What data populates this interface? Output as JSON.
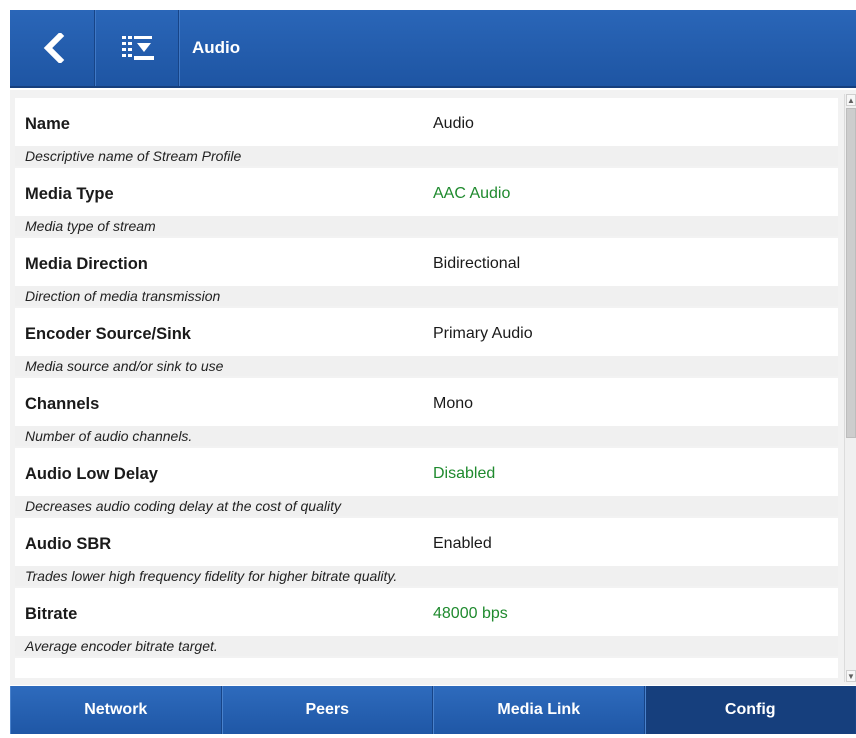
{
  "header": {
    "back_icon": "back-chevron-icon",
    "menu_icon": "list-download-icon",
    "title": "Audio"
  },
  "rows": [
    {
      "name": "Name",
      "value": "Audio",
      "desc": "Descriptive name of Stream Profile",
      "value_color": "#1a1a1a"
    },
    {
      "name": "Media Type",
      "value": "AAC Audio",
      "desc": "Media type of stream",
      "value_color": "#1f8a2e"
    },
    {
      "name": "Media Direction",
      "value": "Bidirectional",
      "desc": "Direction of media transmission",
      "value_color": "#1a1a1a"
    },
    {
      "name": "Encoder Source/Sink",
      "value": "Primary Audio",
      "desc": "Media source and/or sink to use",
      "value_color": "#1a1a1a"
    },
    {
      "name": "Channels",
      "value": "Mono",
      "desc": "Number of audio channels.",
      "value_color": "#1a1a1a"
    },
    {
      "name": "Audio Low Delay",
      "value": "Disabled",
      "desc": "Decreases audio coding delay at the cost of quality",
      "value_color": "#1f8a2e"
    },
    {
      "name": "Audio SBR",
      "value": "Enabled",
      "desc": "Trades lower high frequency fidelity for higher bitrate quality.",
      "value_color": "#1a1a1a"
    },
    {
      "name": "Bitrate",
      "value": "48000 bps",
      "desc": "Average encoder bitrate target.",
      "value_color": "#1f8a2e"
    }
  ],
  "tabs": [
    {
      "label": "Network",
      "active": false
    },
    {
      "label": "Peers",
      "active": false
    },
    {
      "label": "Media Link",
      "active": false
    },
    {
      "label": "Config",
      "active": true
    }
  ],
  "scrollbar": {
    "up_glyph": "▲",
    "down_glyph": "▼"
  },
  "colors": {
    "header_blue": "#1e55a3",
    "active_tab": "#163f7d",
    "value_green": "#1f8a2e"
  }
}
